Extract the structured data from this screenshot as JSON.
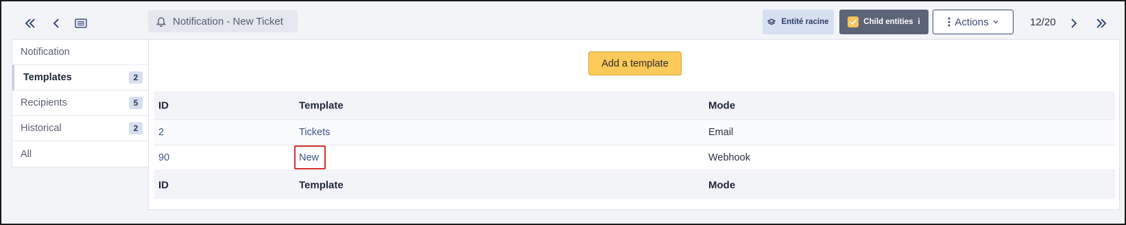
{
  "header": {
    "title": "Notification - New Ticket",
    "entity_label": "Entité racine",
    "child_entities_label": "Child entities",
    "child_entities_info": "i",
    "actions_label": "Actions",
    "counter": "12/20"
  },
  "sidebar": {
    "tabs": [
      {
        "label": "Notification",
        "count": ""
      },
      {
        "label": "Templates",
        "count": "2"
      },
      {
        "label": "Recipients",
        "count": "5"
      },
      {
        "label": "Historical",
        "count": "2"
      },
      {
        "label": "All",
        "count": ""
      }
    ]
  },
  "main": {
    "add_button": "Add a template",
    "columns": [
      "ID",
      "Template",
      "Mode"
    ],
    "rows": [
      {
        "id": "2",
        "template": "Tickets",
        "mode": "Email"
      },
      {
        "id": "90",
        "template": "New",
        "mode": "Webhook"
      }
    ]
  },
  "colors": {
    "accent": "#fbca5a",
    "primary": "#3a4a7a",
    "highlight": "#d23030"
  }
}
